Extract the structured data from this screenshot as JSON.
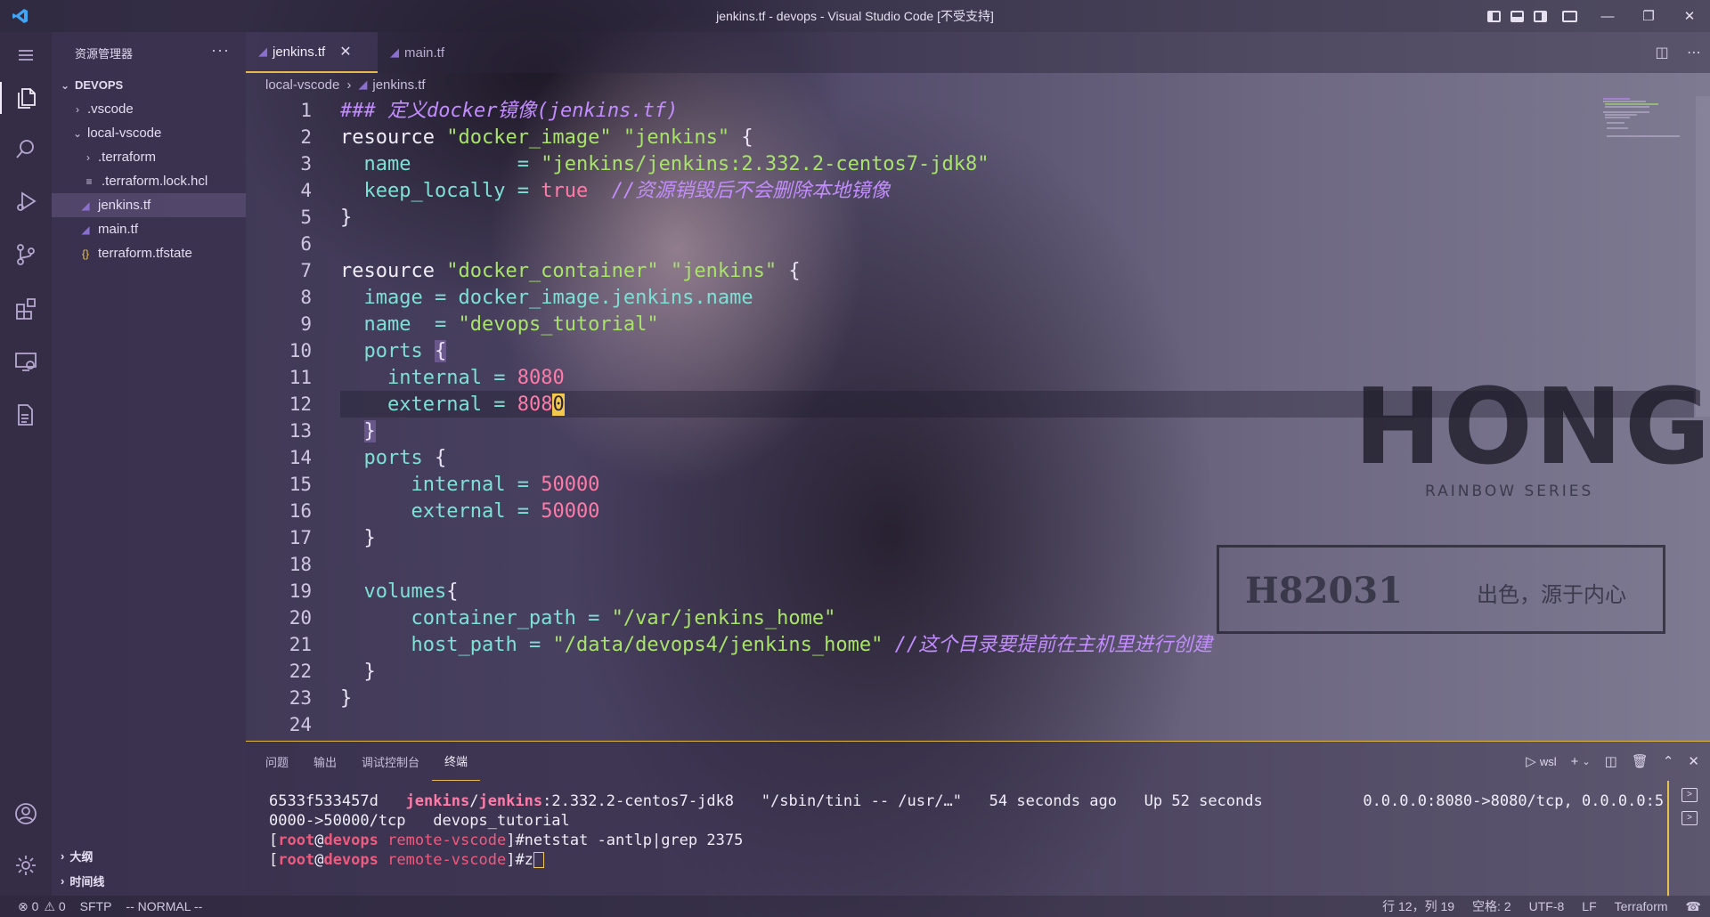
{
  "window": {
    "title": "jenkins.tf - devops - Visual Studio Code [不受支持]"
  },
  "sidebar": {
    "header": "资源管理器",
    "more": "···",
    "root": "DEVOPS",
    "items": [
      {
        "label": ".vscode",
        "type": "folder"
      },
      {
        "label": "local-vscode",
        "type": "folder-open"
      },
      {
        "label": ".terraform",
        "type": "folder"
      },
      {
        "label": ".terraform.lock.hcl",
        "type": "file"
      },
      {
        "label": "jenkins.tf",
        "type": "tf"
      },
      {
        "label": "main.tf",
        "type": "tf"
      },
      {
        "label": "terraform.tfstate",
        "type": "json"
      }
    ],
    "outline": "大纲",
    "timeline": "时间线"
  },
  "tabs": [
    {
      "label": "jenkins.tf",
      "active": true
    },
    {
      "label": "main.tf",
      "active": false
    }
  ],
  "breadcrumb": {
    "folder": "local-vscode",
    "file": "jenkins.tf"
  },
  "editor": {
    "line_numbers": [
      "1",
      "2",
      "3",
      "4",
      "5",
      "6",
      "7",
      "8",
      "9",
      "10",
      "11",
      "12",
      "13",
      "14",
      "15",
      "16",
      "17",
      "18",
      "19",
      "20",
      "21",
      "22",
      "23",
      "24"
    ],
    "current_line": 12
  },
  "background_text": {
    "brand": "HONG",
    "series": "RAINBOW SERIES",
    "code": "H82031",
    "slogan": "出色，源于内心"
  },
  "panel": {
    "tabs": [
      "问题",
      "输出",
      "调试控制台",
      "终端"
    ],
    "active_tab": "终端",
    "shell": "wsl",
    "terminal": {
      "container_id": "6533f533457d",
      "image_user": "jenkins",
      "image_repo": "jenkins",
      "image_tag": ":2.332.2-centos7-jdk8",
      "command": "\"/sbin/tini -- /usr/…\"",
      "created": "54 seconds ago",
      "status": "Up 52 seconds",
      "ports_a": "0.0.0.0:8080->8080/tcp, 0.0.0.0:5",
      "ports_b": "0000->50000/tcp",
      "name": "devops_tutorial",
      "prompt_user": "root",
      "prompt_at": "@",
      "prompt_host": "devops",
      "prompt_dir": "remote-vscode",
      "cmd1": "#netstat -antlp|grep 2375",
      "cmd2": "#z"
    }
  },
  "statusbar": {
    "errors": "⊗ 0",
    "warnings": "⚠ 0",
    "sftp": "SFTP",
    "mode": "-- NORMAL --",
    "position": "行 12，列 19",
    "spaces": "空格: 2",
    "encoding": "UTF-8",
    "eol": "LF",
    "language": "Terraform"
  },
  "colors": {
    "accent": "#e8b84a",
    "string": "#a8e36a",
    "number": "#ff7ba8",
    "attribute": "#7fe0d6",
    "comment": "#c38cff"
  }
}
